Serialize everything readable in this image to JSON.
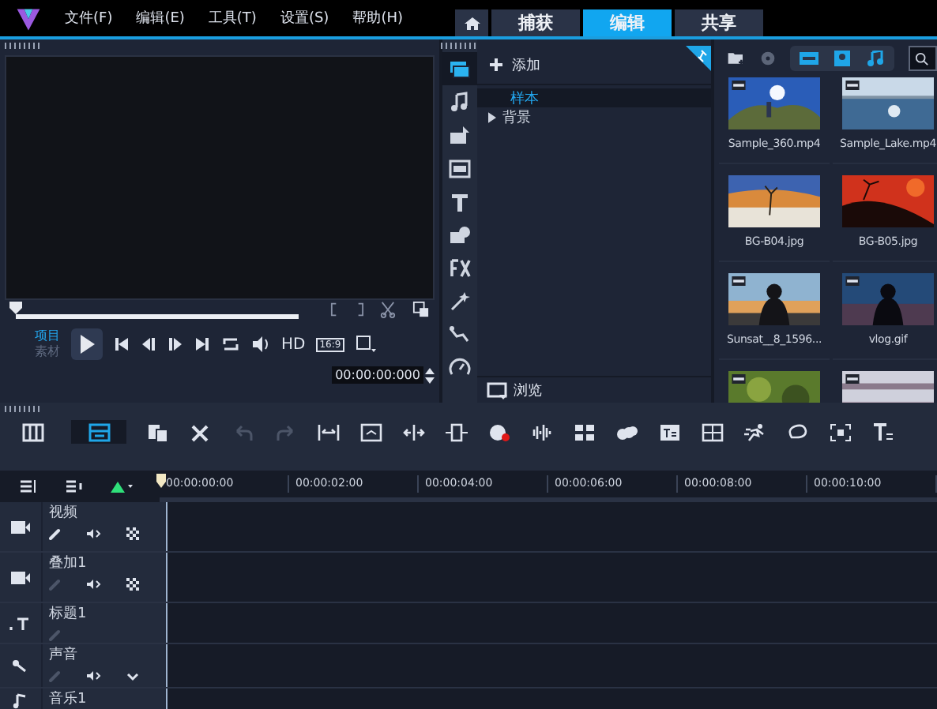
{
  "menu": [
    "文件(F)",
    "编辑(E)",
    "工具(T)",
    "设置(S)",
    "帮助(H)"
  ],
  "tabs": [
    {
      "label": "捕获",
      "selected": false
    },
    {
      "label": "编辑",
      "selected": true
    },
    {
      "label": "共享",
      "selected": false
    }
  ],
  "player": {
    "level": 0,
    "modes": [
      {
        "label": "项目",
        "selected": true
      },
      {
        "label": "素材",
        "selected": false
      }
    ],
    "quality": "HD",
    "aspect": "16:9",
    "timecode": "00:00:00:000"
  },
  "library": {
    "add": "添加",
    "tree": [
      {
        "label": "样本",
        "selected": true,
        "expandable": false
      },
      {
        "label": "背景",
        "selected": false,
        "expandable": true
      }
    ],
    "browse": "浏览",
    "filters": [
      {
        "selected": true
      },
      {
        "selected": true
      },
      {
        "selected": true
      }
    ],
    "items": [
      {
        "label": "Sample_360.mp4",
        "video": true
      },
      {
        "label": "Sample_Lake.mp4",
        "video": true
      },
      {
        "label": "BG-B04.jpg",
        "video": false
      },
      {
        "label": "BG-B05.jpg",
        "video": false
      },
      {
        "label": "Sunsat__8_1596...",
        "video": true
      },
      {
        "label": "vlog.gif",
        "video": true
      },
      {
        "video": true
      },
      {
        "video": true
      }
    ]
  },
  "timeline": {
    "views": [
      {
        "selected": false
      },
      {
        "selected": true
      }
    ],
    "undo_disabled": true,
    "redo_disabled": true,
    "ruler": [
      "00:00:00:00",
      "00:00:02:00",
      "00:00:04:00",
      "00:00:06:00",
      "00:00:08:00",
      "00:00:10:00"
    ],
    "tracks": [
      {
        "kind": "video",
        "name": "视频"
      },
      {
        "kind": "overlay",
        "name": "叠加1"
      },
      {
        "kind": "title",
        "name": "标题1"
      },
      {
        "kind": "voice",
        "name": "声音"
      },
      {
        "kind": "music",
        "name": "音乐1"
      }
    ]
  }
}
